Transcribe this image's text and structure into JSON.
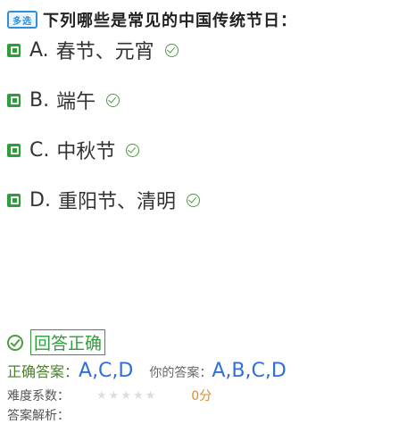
{
  "question": {
    "badge": "多选",
    "title": "下列哪些是常见的中国传统节日："
  },
  "options": [
    {
      "key": "A.",
      "text": "春节、元宵"
    },
    {
      "key": "B.",
      "text": "端午"
    },
    {
      "key": "C.",
      "text": "中秋节"
    },
    {
      "key": "D.",
      "text": "重阳节、清明"
    }
  ],
  "result": {
    "label": "回答正确"
  },
  "answer": {
    "correct_label": "正确答案：",
    "correct_value": "A,C,D",
    "yours_label": "你的答案：",
    "yours_value": "A,B,C,D"
  },
  "difficulty": {
    "label": "难度系数：",
    "stars_total": 5,
    "stars_filled": 0,
    "score": "0分"
  },
  "analysis": {
    "label": "答案解析："
  },
  "colors": {
    "accent_green": "#2e9e3b",
    "answer_blue": "#2f6fd6",
    "badge_blue": "#2f8fdb"
  }
}
